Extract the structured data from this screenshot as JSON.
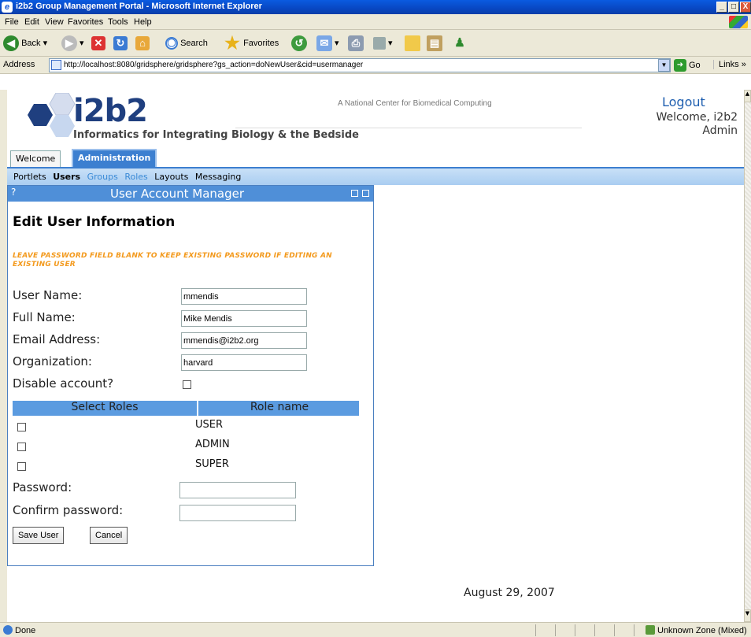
{
  "window": {
    "title": "i2b2 Group Management Portal - Microsoft Internet Explorer",
    "controls": [
      "_",
      "□",
      "X"
    ]
  },
  "menu": [
    "File",
    "Edit",
    "View",
    "Favorites",
    "Tools",
    "Help"
  ],
  "toolbar": {
    "back_label": "Back",
    "search_label": "Search",
    "favorites_label": "Favorites"
  },
  "addressbar": {
    "label": "Address",
    "url": "http://localhost:8080/gridsphere/gridsphere?gs_action=doNewUser&cid=usermanager",
    "go_label": "Go",
    "links_label": "Links"
  },
  "header": {
    "logo_text": "i2b2",
    "logo_subtitle": "Informatics for Integrating Biology & the Bedside",
    "tagline": "A National Center for Biomedical Computing",
    "logout_label": "Logout",
    "welcome_text": "Welcome, i2b2 Admin"
  },
  "tabs": [
    {
      "label": "Welcome",
      "active": false
    },
    {
      "label": "Administration",
      "active": true
    }
  ],
  "subnav": [
    {
      "label": "Portlets",
      "state": "normal"
    },
    {
      "label": "Users",
      "state": "current"
    },
    {
      "label": "Groups",
      "state": "lite"
    },
    {
      "label": "Roles",
      "state": "lite"
    },
    {
      "label": "Layouts",
      "state": "normal"
    },
    {
      "label": "Messaging",
      "state": "normal"
    }
  ],
  "portlet": {
    "help_label": "?",
    "title": "User Account Manager",
    "heading": "Edit User Information",
    "password_note": "LEAVE PASSWORD FIELD BLANK TO KEEP EXISTING PASSWORD IF EDITING AN EXISTING USER",
    "fields": {
      "username": {
        "label": "User Name:",
        "value": "mmendis"
      },
      "fullname": {
        "label": "Full Name:",
        "value": "Mike Mendis"
      },
      "email": {
        "label": "Email Address:",
        "value": "mmendis@i2b2.org"
      },
      "organization": {
        "label": "Organization:",
        "value": "harvard"
      },
      "disable": {
        "label": "Disable account?",
        "checked": false
      },
      "password": {
        "label": "Password:",
        "value": ""
      },
      "confirm": {
        "label": "Confirm password:",
        "value": ""
      }
    },
    "roles": {
      "col_select": "Select Roles",
      "col_name": "Role name",
      "items": [
        {
          "name": "USER",
          "checked": false
        },
        {
          "name": "ADMIN",
          "checked": false
        },
        {
          "name": "SUPER",
          "checked": false
        }
      ]
    },
    "save_label": "Save User",
    "cancel_label": "Cancel"
  },
  "footer": {
    "date": "August 29, 2007"
  },
  "status": {
    "text": "Done",
    "zone": "Unknown Zone (Mixed)"
  },
  "colors": {
    "portlet_title_bg": "#4f8fd8",
    "note_orange": "#f39a1e",
    "tab_active": "#3c7fd0"
  }
}
